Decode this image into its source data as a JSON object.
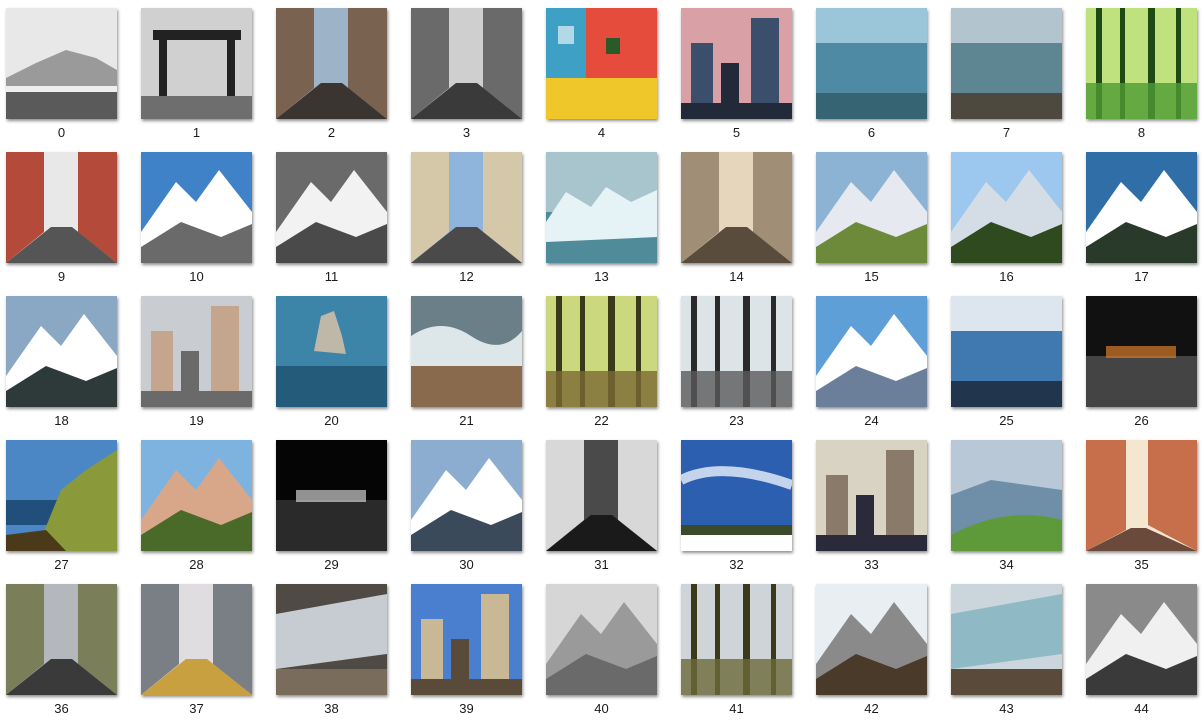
{
  "items": [
    {
      "label": "0",
      "kind": "landscape",
      "mono": true,
      "colors": [
        "#e8e8e8",
        "#9a9a9a",
        "#5a5a5a"
      ]
    },
    {
      "label": "1",
      "kind": "portal",
      "mono": true,
      "colors": [
        "#d0d0d0",
        "#6e6e6e",
        "#222222"
      ]
    },
    {
      "label": "2",
      "kind": "street",
      "colors": [
        "#9db3c8",
        "#7a6250",
        "#3a3530"
      ]
    },
    {
      "label": "3",
      "kind": "street",
      "mono": true,
      "colors": [
        "#cfcfcf",
        "#6a6a6a",
        "#3a3a3a"
      ]
    },
    {
      "label": "4",
      "kind": "facade",
      "colors": [
        "#3ea0c4",
        "#e64c3c",
        "#f0c72a"
      ]
    },
    {
      "label": "5",
      "kind": "city",
      "colors": [
        "#d9a1a6",
        "#3b4f6d",
        "#222a3a"
      ]
    },
    {
      "label": "6",
      "kind": "sea",
      "colors": [
        "#9bc5d9",
        "#4f8aa5",
        "#2f5a66"
      ]
    },
    {
      "label": "7",
      "kind": "sea",
      "colors": [
        "#b2c5cf",
        "#5e8592",
        "#4a3a2a"
      ]
    },
    {
      "label": "8",
      "kind": "forest",
      "colors": [
        "#bfe27e",
        "#4f9b33",
        "#1e4a14"
      ]
    },
    {
      "label": "9",
      "kind": "street",
      "colors": [
        "#e8e8e8",
        "#b44a3a",
        "#555555"
      ]
    },
    {
      "label": "10",
      "kind": "mountain",
      "colors": [
        "#3f82c8",
        "#ffffff",
        "#6a6a6a"
      ]
    },
    {
      "label": "11",
      "kind": "mountain",
      "mono": true,
      "colors": [
        "#6a6a6a",
        "#f2f2f2",
        "#4a4a4a"
      ]
    },
    {
      "label": "12",
      "kind": "street",
      "colors": [
        "#8fb5dd",
        "#d5c8a8",
        "#4a4a4a"
      ]
    },
    {
      "label": "13",
      "kind": "ice",
      "colors": [
        "#a8c4cc",
        "#e6f3f6",
        "#4f8b99"
      ]
    },
    {
      "label": "14",
      "kind": "street",
      "colors": [
        "#e6d6bc",
        "#a08f76",
        "#5a4c3c"
      ]
    },
    {
      "label": "15",
      "kind": "mountain",
      "colors": [
        "#8db3d4",
        "#e6eaf0",
        "#6c8a3a"
      ]
    },
    {
      "label": "16",
      "kind": "mountain",
      "colors": [
        "#9cc7ef",
        "#d4dde6",
        "#2f4a1e"
      ]
    },
    {
      "label": "17",
      "kind": "mountain",
      "colors": [
        "#2f6ea6",
        "#ffffff",
        "#2a3a2a"
      ]
    },
    {
      "label": "18",
      "kind": "mountain",
      "colors": [
        "#8aa8c4",
        "#ffffff",
        "#2e3a3a"
      ]
    },
    {
      "label": "19",
      "kind": "city",
      "colors": [
        "#c9ccd0",
        "#c4a68e",
        "#6a6a6a"
      ]
    },
    {
      "label": "20",
      "kind": "rock",
      "colors": [
        "#3d85a8",
        "#bfb8a9",
        "#245a7a"
      ]
    },
    {
      "label": "21",
      "kind": "wave",
      "colors": [
        "#6b7f88",
        "#dde7ea",
        "#8a6a4c"
      ]
    },
    {
      "label": "22",
      "kind": "forest",
      "colors": [
        "#cbd87e",
        "#7a6a33",
        "#3a3a1a"
      ]
    },
    {
      "label": "23",
      "kind": "forest",
      "colors": [
        "#dce4e8",
        "#5a5a5a",
        "#2a2a2a"
      ]
    },
    {
      "label": "24",
      "kind": "mountain",
      "colors": [
        "#5f9fd8",
        "#ffffff",
        "#6c7f9a"
      ]
    },
    {
      "label": "25",
      "kind": "sea",
      "colors": [
        "#dde6ef",
        "#3f79b0",
        "#1a2533"
      ]
    },
    {
      "label": "26",
      "kind": "night",
      "colors": [
        "#111111",
        "#d97a2a",
        "#444444"
      ]
    },
    {
      "label": "27",
      "kind": "coast",
      "colors": [
        "#4a87c4",
        "#8a9a3a",
        "#4a3a1a"
      ]
    },
    {
      "label": "28",
      "kind": "mountain",
      "colors": [
        "#7eb3e0",
        "#d8a78a",
        "#4a6a2a"
      ]
    },
    {
      "label": "29",
      "kind": "night",
      "mono": true,
      "colors": [
        "#050505",
        "#cfcfcf",
        "#2a2a2a"
      ]
    },
    {
      "label": "30",
      "kind": "mountain",
      "colors": [
        "#8dadd0",
        "#ffffff",
        "#3a4a5a"
      ]
    },
    {
      "label": "31",
      "kind": "street",
      "mono": true,
      "colors": [
        "#4a4a4a",
        "#d8d8d8",
        "#1a1a1a"
      ]
    },
    {
      "label": "32",
      "kind": "sky",
      "colors": [
        "#2d5fb0",
        "#eaf1fb",
        "#3a4a2a"
      ]
    },
    {
      "label": "33",
      "kind": "city",
      "colors": [
        "#d9d3c4",
        "#8a7a6a",
        "#2a2a3a"
      ]
    },
    {
      "label": "34",
      "kind": "valley",
      "colors": [
        "#b9c8d6",
        "#6f8fa8",
        "#5f9a3a"
      ]
    },
    {
      "label": "35",
      "kind": "alley",
      "colors": [
        "#c76f4a",
        "#f5e6d0",
        "#6a4a3a"
      ]
    },
    {
      "label": "36",
      "kind": "street",
      "colors": [
        "#b4b8bc",
        "#7a7f5a",
        "#3a3a3a"
      ]
    },
    {
      "label": "37",
      "kind": "street",
      "colors": [
        "#e0dde0",
        "#7a7f86",
        "#c9a040"
      ]
    },
    {
      "label": "38",
      "kind": "glacier",
      "colors": [
        "#504a44",
        "#c6ccd2",
        "#7a6c5a"
      ]
    },
    {
      "label": "39",
      "kind": "city",
      "colors": [
        "#4a7fcf",
        "#c9b896",
        "#5a4a3a"
      ]
    },
    {
      "label": "40",
      "kind": "mountain",
      "mono": true,
      "colors": [
        "#d6d6d6",
        "#9a9a9a",
        "#6a6a6a"
      ]
    },
    {
      "label": "41",
      "kind": "forest",
      "colors": [
        "#cfd4d8",
        "#6a6a3a",
        "#3a3a1a"
      ]
    },
    {
      "label": "42",
      "kind": "mountain",
      "colors": [
        "#e8eef2",
        "#8a8a8a",
        "#4a3a2a"
      ]
    },
    {
      "label": "43",
      "kind": "glacier",
      "colors": [
        "#cad5dc",
        "#8fb9c4",
        "#5a4a3a"
      ]
    },
    {
      "label": "44",
      "kind": "mountain",
      "mono": true,
      "colors": [
        "#8a8a8a",
        "#f0f0f0",
        "#3a3a3a"
      ]
    }
  ]
}
